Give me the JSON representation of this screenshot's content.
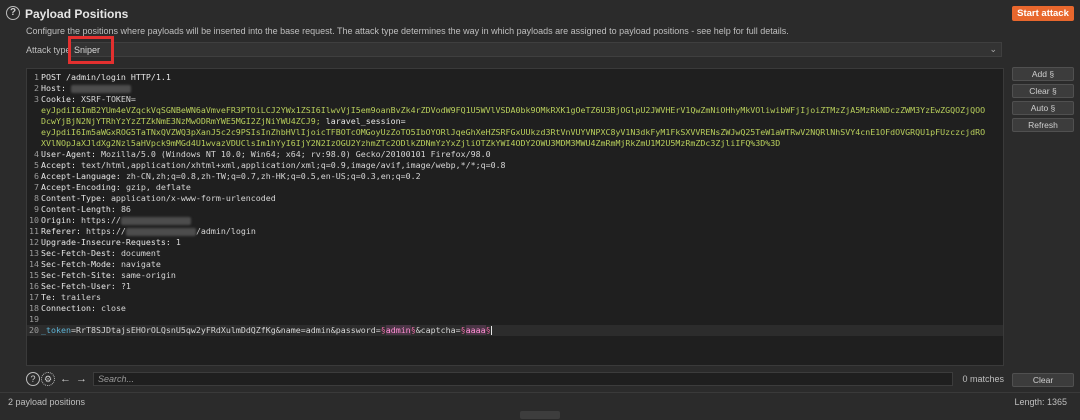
{
  "header": {
    "title": "Payload Positions",
    "description": "Configure the positions where payloads will be inserted into the base request. The attack type determines the way in which payloads are assigned to payload positions - see help for full details.",
    "start_attack_label": "Start attack"
  },
  "attack": {
    "label": "Attack type:",
    "value": "Sniper"
  },
  "editor": {
    "lines": [
      {
        "n": "1",
        "text": "POST /admin/login HTTP/1.1"
      },
      {
        "n": "2",
        "name": "Host:"
      },
      {
        "n": "3",
        "name": "Cookie:",
        "value": "XSRF-TOKEN="
      },
      {
        "n": "",
        "cookie": "eyJpdiI6ImB2YUm4eVZqckVqSGNBeWN6aVmveFR3PTOiLCJ2YWx1ZSI6IlwvVjI5em9oanBvZk4rZDVodW9FQ1U5WVlVSDA0bk9OMkRXK1gOeTZ6U3BjOGlpU2JWVHErV1QwZmNiOHhyMkVOliwibWFjIjoiZTMzZjA5MzRkNDczZWM3YzEwZGQOZjQOO"
      },
      {
        "n": "",
        "cookie": "DcwYjBjN2NjYTRhYzYzZTZkNmE3NzMwODRmYWE5MGI2ZjNiYWU4ZCJ9;",
        "name": "laravel_session="
      },
      {
        "n": "",
        "cookie": "eyJpdiI6Im5aWGxROG5TaTNxQVZWQ3pXanJ5c2c9PSIsInZhbHVlIjoicTFBOTcOMGoyUzZoTO5IbOYORlJqeGhXeHZSRFGxUUkzd3RtVnVUYVNPXC8yV1N3dkFyM1FkSXVVRENsZWJwQ25TeW1aWTRwV2NQRlNhSVY4cnE1OFdOVGRQU1pFUzczcjdRO"
      },
      {
        "n": "",
        "cookie": "XVlNOpJaXJldXg2Nzl5aHVpck9mMGd4U1wvazVDUClsIm1hYyI6IjY2N2IzOGU2YzhmZTc2ODlkZDNmYzYxZjliOTZkYWI4ODY2OWU3MDM3MWU4ZmRmMjRkZmU1M2U5MzRmZDc3ZjliIFQ%3D%3D"
      },
      {
        "n": "4",
        "name": "User-Agent:",
        "value": "Mozilla/5.0 (Windows NT 10.0; Win64; x64; rv:98.0) Gecko/20100101 Firefox/98.0"
      },
      {
        "n": "5",
        "name": "Accept:",
        "value": "text/html,application/xhtml+xml,application/xml;q=0.9,image/avif,image/webp,*/*;q=0.8"
      },
      {
        "n": "6",
        "name": "Accept-Language:",
        "value": "zh-CN,zh;q=0.8,zh-TW;q=0.7,zh-HK;q=0.5,en-US;q=0.3,en;q=0.2"
      },
      {
        "n": "7",
        "name": "Accept-Encoding:",
        "value": "gzip, deflate"
      },
      {
        "n": "8",
        "name": "Content-Type:",
        "value": "application/x-www-form-urlencoded"
      },
      {
        "n": "9",
        "name": "Content-Length:",
        "value": "86"
      },
      {
        "n": "10",
        "name": "Origin:",
        "value": "https://"
      },
      {
        "n": "11",
        "name": "Referer:",
        "value": "https://",
        "suffix": "/admin/login"
      },
      {
        "n": "12",
        "name": "Upgrade-Insecure-Requests:",
        "value": "1"
      },
      {
        "n": "13",
        "name": "Sec-Fetch-Dest:",
        "value": "document"
      },
      {
        "n": "14",
        "name": "Sec-Fetch-Mode:",
        "value": "navigate"
      },
      {
        "n": "15",
        "name": "Sec-Fetch-Site:",
        "value": "same-origin"
      },
      {
        "n": "16",
        "name": "Sec-Fetch-User:",
        "value": "?1"
      },
      {
        "n": "17",
        "name": "Te:",
        "value": "trailers"
      },
      {
        "n": "18",
        "name": "Connection:",
        "value": "close"
      },
      {
        "n": "19",
        "text": ""
      },
      {
        "n": "20",
        "body": true
      }
    ],
    "body": {
      "token_key": "_token",
      "token_value": "=RrT8SJDtajsEHOrOLQsnU5qw2yFRdXulmDdQZfKg",
      "name_part": "&name=admin&password=",
      "payload1": "admin",
      "captcha_part": "&captcha=",
      "payload2": "aaaa",
      "marker": "§"
    }
  },
  "side_buttons": [
    "Add §",
    "Clear §",
    "Auto §",
    "Refresh"
  ],
  "search": {
    "placeholder": "Search...",
    "matches": "0 matches",
    "clear_label": "Clear"
  },
  "status": {
    "positions": "2 payload positions",
    "length": "Length: 1365"
  },
  "icons": {
    "help": "help-icon",
    "settings": "gear-icon",
    "back": "arrow-left-icon",
    "forward": "arrow-right-icon"
  },
  "colors": {
    "accent": "#e8672d",
    "highlight_box": "#e3302f",
    "cookie_value": "#b8cf5c",
    "payload": "#ff8fd4"
  }
}
